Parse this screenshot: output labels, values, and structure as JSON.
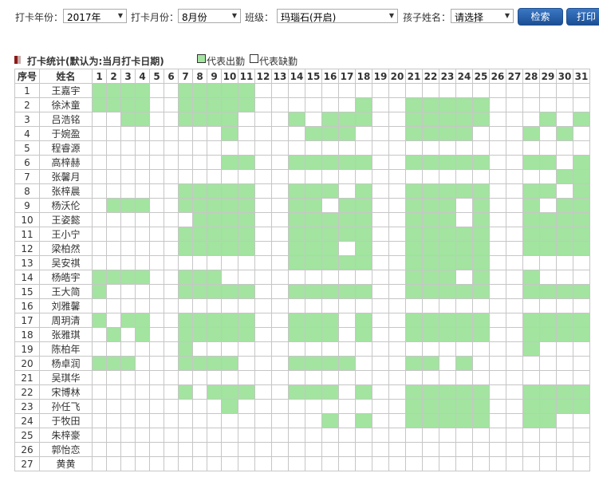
{
  "filters": {
    "year_label": "打卡年份：",
    "year_value": "2017年",
    "month_label": "打卡月份：",
    "month_value": "8月份",
    "class_label": "班级：",
    "class_value": "玛瑙石(开启)",
    "child_label": "孩子姓名：",
    "child_value": "请选择",
    "search_label": "检索",
    "print_label": "打印"
  },
  "section": {
    "title": "打卡统计(默认为:当月打卡日期)",
    "legend_present": "代表出勤",
    "legend_absent": "代表缺勤"
  },
  "colors": {
    "present": "#a2e4a0",
    "button": "#2a62ae",
    "title_mark": "#8b1a1a"
  },
  "table": {
    "seq_header": "序号",
    "name_header": "姓名",
    "days": [
      "1",
      "2",
      "3",
      "4",
      "5",
      "6",
      "7",
      "8",
      "9",
      "10",
      "11",
      "12",
      "13",
      "14",
      "15",
      "16",
      "17",
      "18",
      "19",
      "20",
      "21",
      "22",
      "23",
      "24",
      "25",
      "26",
      "27",
      "28",
      "29",
      "30",
      "31"
    ],
    "rows": [
      {
        "seq": "1",
        "name": "王嘉宇",
        "present": [
          1,
          2,
          3,
          4,
          7,
          8,
          9,
          10,
          11
        ]
      },
      {
        "seq": "2",
        "name": "徐沐童",
        "present": [
          1,
          2,
          3,
          4,
          7,
          8,
          9,
          10,
          11,
          18,
          21,
          22,
          23,
          24,
          25
        ]
      },
      {
        "seq": "3",
        "name": "吕浩铭",
        "present": [
          3,
          4,
          7,
          8,
          9,
          10,
          14,
          16,
          17,
          18,
          21,
          22,
          23,
          24,
          25,
          29,
          31
        ]
      },
      {
        "seq": "4",
        "name": "于婉盈",
        "present": [
          10,
          15,
          16,
          17,
          21,
          22,
          23,
          24,
          28,
          30
        ]
      },
      {
        "seq": "5",
        "name": "程睿源",
        "present": []
      },
      {
        "seq": "6",
        "name": "高梓赫",
        "present": [
          10,
          11,
          14,
          15,
          16,
          17,
          18,
          21,
          22,
          23,
          24,
          25,
          28,
          29,
          31
        ]
      },
      {
        "seq": "7",
        "name": "张馨月",
        "present": [
          30,
          31
        ]
      },
      {
        "seq": "8",
        "name": "张梓晨",
        "present": [
          7,
          8,
          9,
          10,
          11,
          14,
          15,
          16,
          18,
          21,
          22,
          23,
          24,
          25,
          28,
          29,
          31
        ]
      },
      {
        "seq": "9",
        "name": "杨沃伦",
        "present": [
          2,
          3,
          4,
          7,
          8,
          9,
          10,
          11,
          14,
          15,
          17,
          18,
          21,
          22,
          23,
          25,
          28,
          30,
          31
        ]
      },
      {
        "seq": "10",
        "name": "王姿懿",
        "present": [
          8,
          9,
          10,
          11,
          14,
          15,
          16,
          17,
          18,
          21,
          22,
          23,
          25,
          28,
          29,
          30,
          31
        ]
      },
      {
        "seq": "11",
        "name": "王小宁",
        "present": [
          7,
          8,
          9,
          10,
          11,
          14,
          15,
          16,
          17,
          18,
          21,
          22,
          23,
          24,
          25,
          28,
          29,
          30,
          31
        ]
      },
      {
        "seq": "12",
        "name": "梁柏然",
        "present": [
          7,
          8,
          9,
          10,
          11,
          14,
          15,
          16,
          18,
          21,
          22,
          23,
          24,
          25,
          28,
          29,
          30,
          31
        ]
      },
      {
        "seq": "13",
        "name": "吴安祺",
        "present": [
          14,
          15,
          16,
          17,
          18,
          21,
          22,
          23,
          24,
          25
        ]
      },
      {
        "seq": "14",
        "name": "杨皓宇",
        "present": [
          1,
          2,
          3,
          4,
          7,
          8,
          9,
          21,
          22,
          23,
          25,
          28
        ]
      },
      {
        "seq": "15",
        "name": "王大简",
        "present": [
          1,
          7,
          8,
          9,
          10,
          11,
          14,
          15,
          16,
          17,
          18,
          21,
          22,
          23,
          24,
          25,
          28,
          29,
          30,
          31
        ]
      },
      {
        "seq": "16",
        "name": "刘雅馨",
        "present": []
      },
      {
        "seq": "17",
        "name": "周玥清",
        "present": [
          1,
          3,
          4,
          7,
          8,
          9,
          10,
          11,
          14,
          15,
          16,
          18,
          21,
          22,
          23,
          24,
          25,
          28,
          29,
          30,
          31
        ]
      },
      {
        "seq": "18",
        "name": "张雅琪",
        "present": [
          2,
          4,
          7,
          8,
          9,
          10,
          11,
          14,
          15,
          16,
          18,
          21,
          22,
          23,
          24,
          25,
          28,
          29,
          30,
          31
        ]
      },
      {
        "seq": "19",
        "name": "陈柏年",
        "present": [
          7,
          28
        ]
      },
      {
        "seq": "20",
        "name": "杨卓润",
        "present": [
          1,
          2,
          3,
          7,
          8,
          9,
          10,
          14,
          15,
          16,
          17,
          21,
          22,
          24
        ]
      },
      {
        "seq": "21",
        "name": "吴琪华",
        "present": []
      },
      {
        "seq": "22",
        "name": "宋博林",
        "present": [
          7,
          9,
          10,
          11,
          14,
          15,
          16,
          18,
          21,
          22,
          23,
          24,
          25,
          28,
          29,
          30,
          31
        ]
      },
      {
        "seq": "23",
        "name": "孙任飞",
        "present": [
          10,
          21,
          22,
          23,
          24,
          25,
          28,
          29,
          30,
          31
        ]
      },
      {
        "seq": "24",
        "name": "于牧田",
        "present": [
          16,
          18,
          21,
          22,
          23,
          24,
          25,
          28,
          29
        ]
      },
      {
        "seq": "25",
        "name": "朱梓豪",
        "present": []
      },
      {
        "seq": "26",
        "name": "郭怡恋",
        "present": []
      },
      {
        "seq": "27",
        "name": "黄黄",
        "present": []
      }
    ]
  }
}
